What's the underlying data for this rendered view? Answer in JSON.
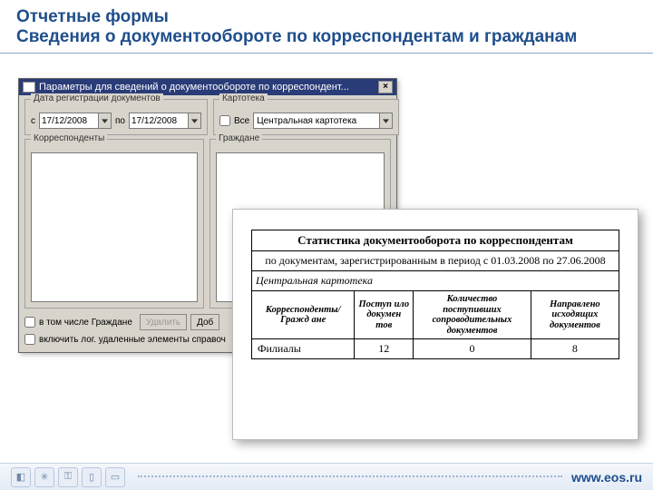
{
  "header": {
    "title_line1": "Отчетные формы",
    "title_line2": "Сведения о документообороте по корреспондентам и гражданам"
  },
  "dialog": {
    "title": "Параметры для сведений о документообороте по корреспондент...",
    "date_group": "Дата регистрации документов",
    "from_label": "с",
    "from_value": "17/12/2008",
    "to_label": "по",
    "to_value": "17/12/2008",
    "card_group": "Картотека",
    "all_label": "Все",
    "card_value": "Центральная картотека",
    "corr_group": "Корреспонденты",
    "cit_group": "Граждане",
    "incl_citizens": "в том числе Граждане",
    "incl_deleted": "включить лог. удаленные элементы справоч",
    "btn_delete": "Удалить",
    "btn_add": "Доб"
  },
  "report": {
    "title": "Статистика документооборота по корреспондентам",
    "subtitle": "по документам, зарегистрированным в период с 01.03.2008 по 27.06.2008",
    "location": "Центральная картотека",
    "headers": {
      "h1": "Корреспонденты/Гражд\nане",
      "h2": "Поступ\nило\nдокумен\nтов",
      "h3": "Количество\nпоступивших\nсопроводительных\nдокументов",
      "h4": "Направлено\nисходящих\nдокументов"
    },
    "row": {
      "name": "Филиалы",
      "c1": "12",
      "c2": "0",
      "c3": "8"
    }
  },
  "footer": {
    "site": "www.eos.ru"
  }
}
